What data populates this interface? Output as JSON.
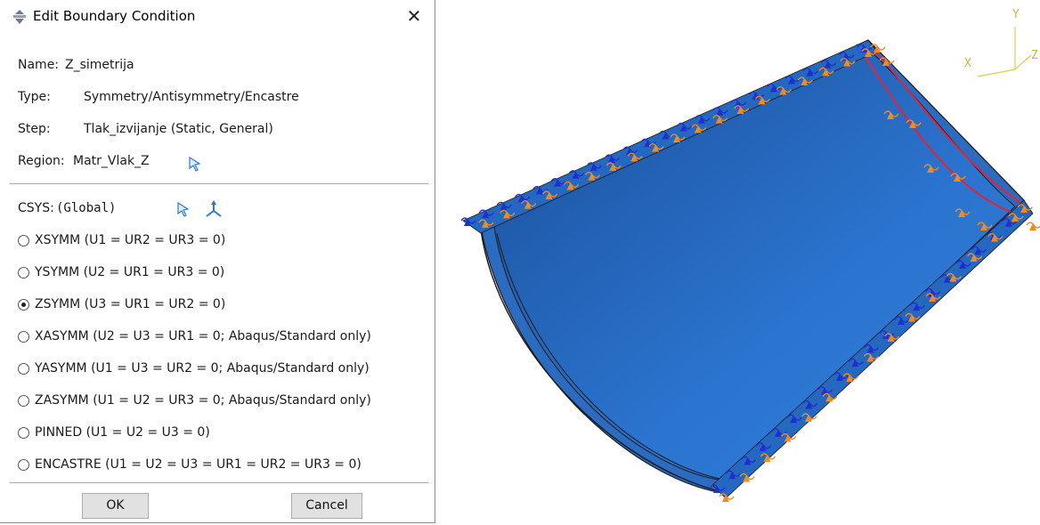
{
  "dialog": {
    "title": "Edit Boundary Condition",
    "close_glyph": "✕",
    "name_label": "Name:",
    "name_value": "Z_simetrija",
    "type_label": "Type:",
    "type_value": "Symmetry/Antisymmetry/Encastre",
    "step_label": "Step:",
    "step_value": "Tlak_izvijanje (Static, General)",
    "region_label": "Region:",
    "region_value": "Matr_Vlak_Z",
    "csys_label": "CSYS:",
    "csys_value": "(Global)",
    "options": [
      {
        "label": "XSYMM (U1 = UR2 = UR3 = 0)",
        "selected": false
      },
      {
        "label": "YSYMM (U2 = UR1 = UR3 = 0)",
        "selected": false
      },
      {
        "label": "ZSYMM (U3 = UR1 = UR2 = 0)",
        "selected": true
      },
      {
        "label": "XASYMM (U2 = U3 = UR1 = 0; Abaqus/Standard only)",
        "selected": false
      },
      {
        "label": "YASYMM (U1 = U3 = UR2 = 0; Abaqus/Standard only)",
        "selected": false
      },
      {
        "label": "ZASYMM (U1 = U2 = UR3 = 0; Abaqus/Standard only)",
        "selected": false
      },
      {
        "label": "PINNED (U1 = U2 = U3 = 0)",
        "selected": false
      },
      {
        "label": "ENCASTRE (U1 = U2 = U3 = UR1 = UR2 = UR3 = 0)",
        "selected": false
      }
    ],
    "ok_label": "OK",
    "cancel_label": "Cancel",
    "icons": [
      "abaqus-bc-icon",
      "close-icon",
      "select-arrow-icon",
      "csys-triad-icon"
    ]
  },
  "viewport": {
    "triad": {
      "x_label": "X",
      "y_label": "Y",
      "z_label": "Z"
    },
    "colors": {
      "part": "#2a6fc4",
      "part_dark": "#1d5aa8",
      "edge": "#1a1a1a",
      "bc_marker": "#f08a24",
      "load_marker": "#1f2fd0",
      "selected_edge": "#e0243a"
    }
  }
}
